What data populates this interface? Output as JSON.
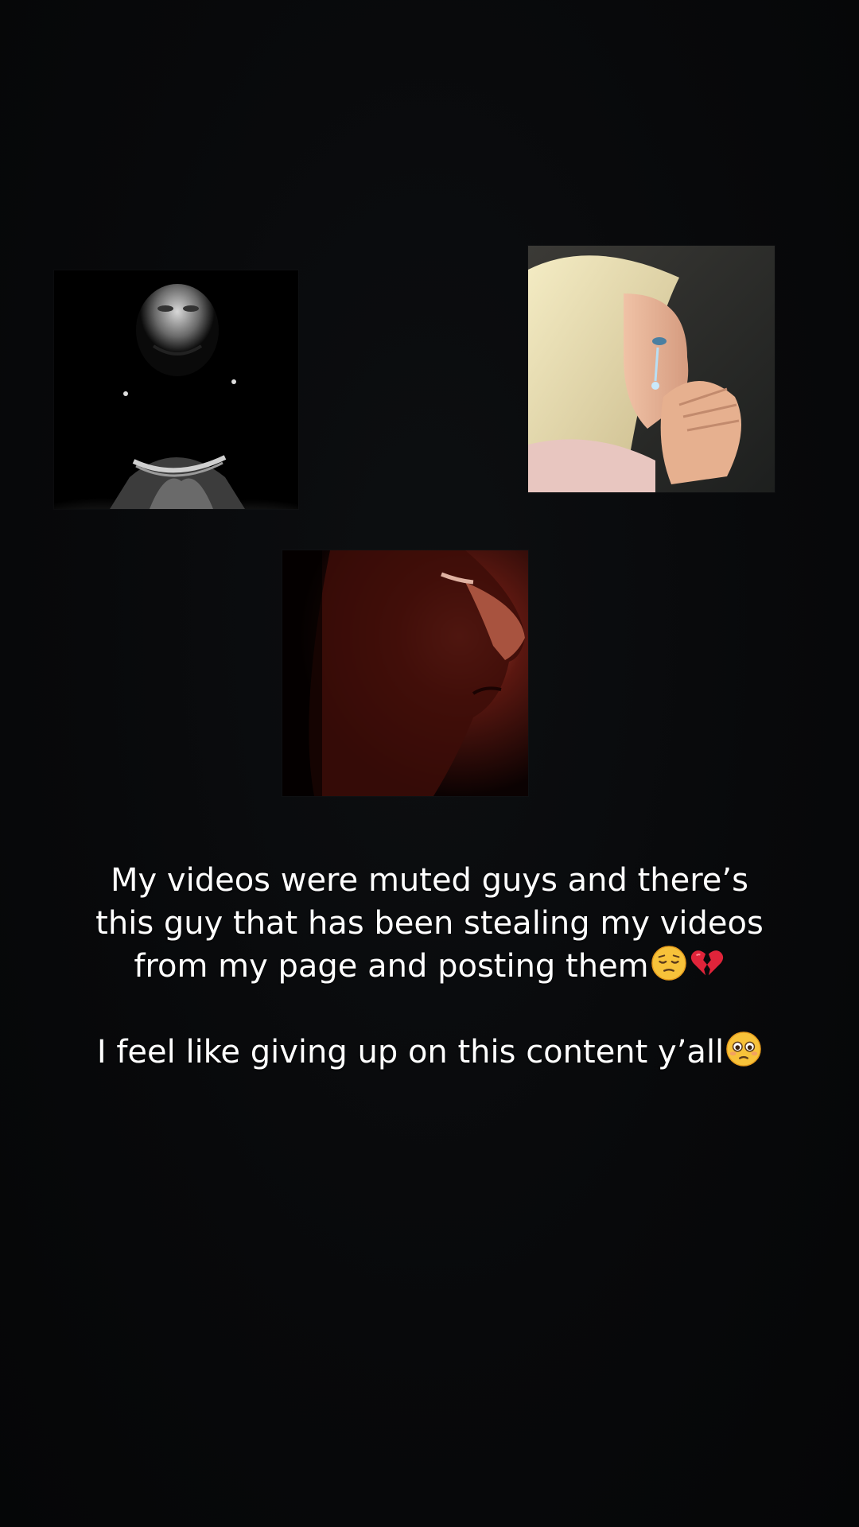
{
  "images": [
    {
      "name": "grayscale-man-photo",
      "icon": "man-looking-up-image"
    },
    {
      "name": "crying-doll-photo",
      "icon": "crying-doll-image"
    },
    {
      "name": "red-lit-face-photo",
      "icon": "man-profile-image"
    }
  ],
  "caption": {
    "paragraph_1": "My videos were muted guys and there’s this guy that has been stealing my videos from my page and posting them",
    "paragraph_1_emojis": [
      "pensive-face-emoji",
      "broken-heart-emoji"
    ],
    "paragraph_2": "I feel like giving up on this content y’all",
    "paragraph_2_emojis": [
      "flushed-pleading-face-emoji"
    ]
  },
  "colors": {
    "background": "#070809",
    "text": "#ffffff"
  }
}
